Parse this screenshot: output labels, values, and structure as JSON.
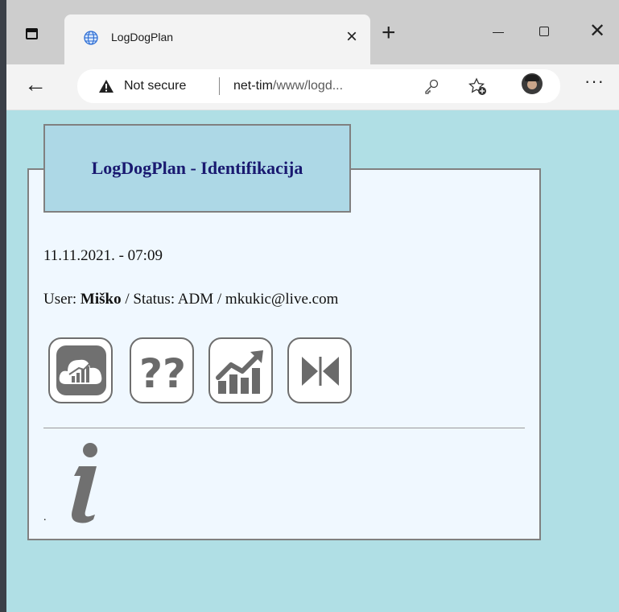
{
  "browser": {
    "tab_title": "LogDogPlan",
    "tab_close_glyph": "×",
    "new_tab_glyph": "+",
    "window_close_glyph": "✕",
    "back_glyph": "←",
    "security_label": "Not secure",
    "url_host": "net-tim",
    "url_path": "/www/logd...",
    "more_glyph": "···",
    "icons": [
      "tab-actions-icon",
      "globe-icon",
      "warning-icon",
      "key-icon",
      "add-favorite-icon",
      "profile-avatar",
      "minimize-icon",
      "maximize-icon",
      "close-icon"
    ]
  },
  "page": {
    "legend": "LogDogPlan - Identifikacija",
    "datetime": "11.11.2021. - 07:09",
    "user_prefix": "User: ",
    "user_name": "Miško",
    "user_suffix": " / Status: ADM / mkukic@live.com",
    "buttons": [
      {
        "name": "cloud-analytics-button",
        "icon": "cloud-chart-icon"
      },
      {
        "name": "help-button",
        "icon": "question-marks-icon",
        "text": "??"
      },
      {
        "name": "statistics-button",
        "icon": "trend-chart-icon"
      },
      {
        "name": "exit-button",
        "icon": "collapse-arrows-icon"
      }
    ],
    "info_icon": "info-icon",
    "footer_dot": ".",
    "colors": {
      "page_bg": "#b0dfe5",
      "panel_bg": "#f0f8ff",
      "legend_bg": "#add8e6",
      "legend_text": "#191970",
      "border": "#808080"
    }
  }
}
